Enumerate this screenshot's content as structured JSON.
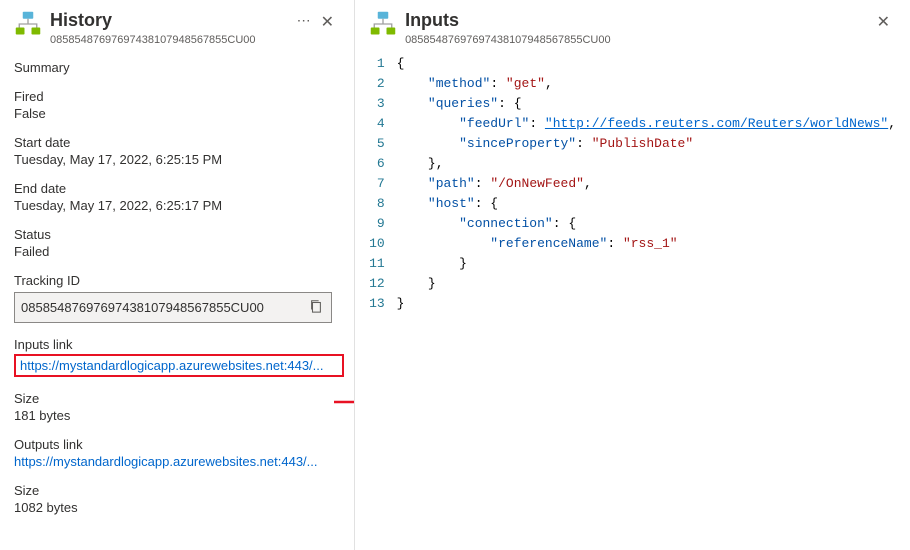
{
  "left": {
    "title": "History",
    "subtitle": "08585487697697438107948567855CU00",
    "summary_label": "Summary",
    "fired_label": "Fired",
    "fired_value": "False",
    "start_date_label": "Start date",
    "start_date_value": "Tuesday, May 17, 2022, 6:25:15 PM",
    "end_date_label": "End date",
    "end_date_value": "Tuesday, May 17, 2022, 6:25:17 PM",
    "status_label": "Status",
    "status_value": "Failed",
    "tracking_id_label": "Tracking ID",
    "tracking_id_value": "08585487697697438107948567855CU00",
    "inputs_link_label": "Inputs link",
    "inputs_link_value": "https://mystandardlogicapp.azurewebsites.net:443/...",
    "inputs_size_label": "Size",
    "inputs_size_value": "181 bytes",
    "outputs_link_label": "Outputs link",
    "outputs_link_value": "https://mystandardlogicapp.azurewebsites.net:443/...",
    "outputs_size_label": "Size",
    "outputs_size_value": "1082 bytes"
  },
  "right": {
    "title": "Inputs",
    "subtitle": "08585487697697438107948567855CU00",
    "code": {
      "method_key": "\"method\"",
      "method_val": "\"get\"",
      "queries_key": "\"queries\"",
      "feedUrl_key": "\"feedUrl\"",
      "feedUrl_val": "\"http://feeds.reuters.com/Reuters/worldNews\"",
      "sinceProperty_key": "\"sinceProperty\"",
      "sinceProperty_val": "\"PublishDate\"",
      "path_key": "\"path\"",
      "path_val": "\"/OnNewFeed\"",
      "host_key": "\"host\"",
      "connection_key": "\"connection\"",
      "referenceName_key": "\"referenceName\"",
      "referenceName_val": "\"rss_1\""
    }
  }
}
